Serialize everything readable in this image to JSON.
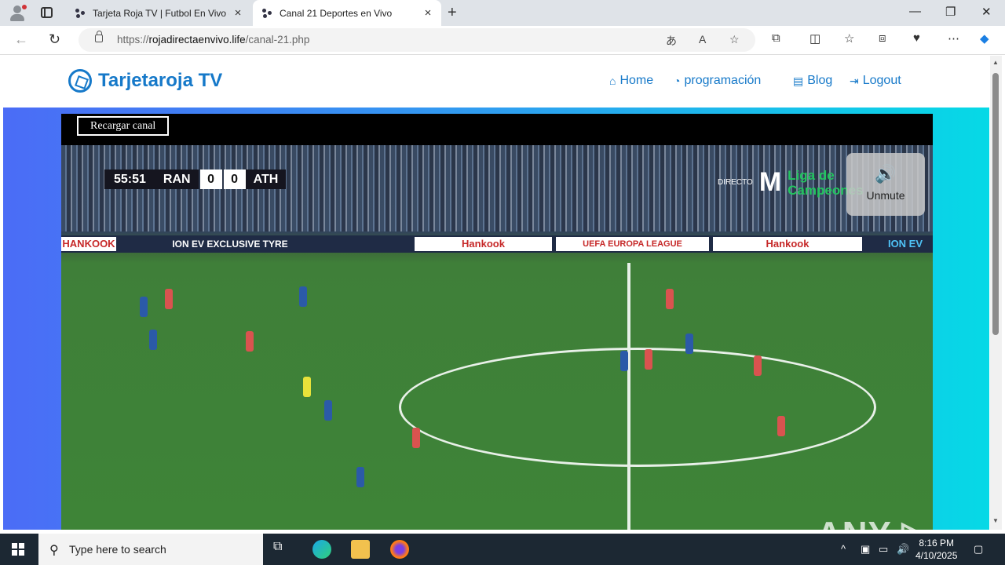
{
  "browser": {
    "tabs": [
      {
        "title": "Tarjeta Roja TV | Futbol En Vivo - ",
        "close": "×"
      },
      {
        "title": "Canal 21 Deportes en Vivo",
        "close": "×"
      }
    ],
    "new_tab": "+",
    "url_scheme": "https://",
    "url_host": "rojadirectaenvivo.life",
    "url_path": "/canal-21.php",
    "window_controls": {
      "minimize": "—",
      "maximize": "❐",
      "close": "✕"
    }
  },
  "site": {
    "logo": "Tarjetaroja TV",
    "menu": [
      {
        "icon": "⌂",
        "label": "Home"
      },
      {
        "icon": "◔",
        "label": "programación"
      },
      {
        "icon": "▤",
        "label": "Blog"
      },
      {
        "icon": "⇥",
        "label": "Logout"
      }
    ]
  },
  "player": {
    "reload_label": "Recargar canal",
    "unmute_label": "Unmute",
    "scoreboard": {
      "time": "55:51",
      "home": "RAN",
      "home_score": "0",
      "away_score": "0",
      "away": "ATH"
    },
    "broadcaster": {
      "label": "DIRECTO",
      "brand": "M",
      "line1": "Liga de",
      "line2": "Campeones"
    },
    "ads": [
      "HANKOOK",
      "ION EV EXCLUSIVE TYRE",
      "Hankook",
      "UEFA EUROPA LEAGUE",
      "Hankook",
      "ION EV"
    ],
    "watermark": "ANY ▷ RUN"
  },
  "taskbar": {
    "search_placeholder": "Type here to search",
    "time": "8:16 PM",
    "date": "4/10/2025"
  },
  "colors": {
    "accent": "#1679c9",
    "hero_left": "#4b6cf6",
    "hero_right": "#06d9e6"
  }
}
